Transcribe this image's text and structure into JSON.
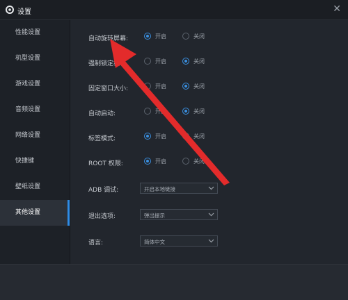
{
  "window": {
    "title": "设置",
    "close_symbol": "✕"
  },
  "sidebar": {
    "items": [
      {
        "label": "性能设置",
        "active": false
      },
      {
        "label": "机型设置",
        "active": false
      },
      {
        "label": "游戏设置",
        "active": false
      },
      {
        "label": "音频设置",
        "active": false
      },
      {
        "label": "网络设置",
        "active": false
      },
      {
        "label": "快捷键",
        "active": false
      },
      {
        "label": "壁纸设置",
        "active": false
      },
      {
        "label": "其他设置",
        "active": true
      }
    ]
  },
  "settings": {
    "auto_rotate": {
      "label": "自动旋转屏幕:",
      "on": "开启",
      "off": "关闭",
      "value": "on"
    },
    "force_lock": {
      "label": "强制锁定横",
      "on": "开启",
      "off": "关闭",
      "value": "off"
    },
    "fixed_window": {
      "label": "固定窗口大小:",
      "on": "开启",
      "off": "关闭",
      "value": "off"
    },
    "auto_start": {
      "label": "自动启动:",
      "on": "开启",
      "off": "关闭",
      "value": "off"
    },
    "tab_mode": {
      "label": "标签模式:",
      "on": "开启",
      "off": "关闭",
      "value": "on"
    },
    "root": {
      "label": "ROOT 权限:",
      "on": "开启",
      "off": "关闭",
      "value": "on"
    },
    "adb": {
      "label": "ADB 调试:",
      "value": "开启本地链接"
    },
    "exit_option": {
      "label": "退出选项:",
      "value": "弹出提示"
    },
    "language": {
      "label": "语言:",
      "value": "简体中文"
    }
  },
  "icons": {
    "app": "gear-icon",
    "close": "close-icon",
    "dropdown": "chevron-down-icon",
    "annotation": "red-arrow"
  },
  "colors": {
    "accent": "#3a8fe0",
    "annotation_arrow": "#e32b2b"
  }
}
